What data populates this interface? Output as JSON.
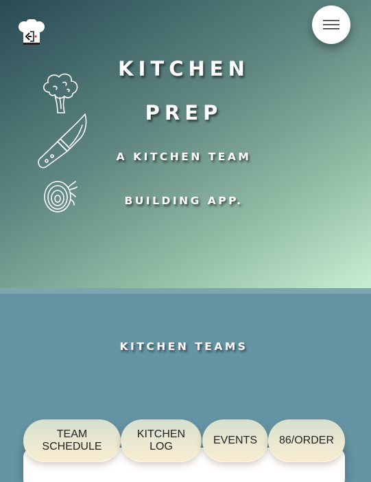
{
  "header": {
    "logo_icon": "chef-hat-code-logo-icon",
    "menu_icon": "hamburger-menu-icon"
  },
  "hero": {
    "title_line_1": "KITCHEN",
    "title_line_2": "PREP",
    "tagline_line_1": "A KITCHEN TEAM",
    "tagline_line_2": "BUILDING APP.",
    "illustrations": [
      "broccoli-icon",
      "chef-knife-icon",
      "onion-icon"
    ]
  },
  "teams": {
    "section_title": "KITCHEN TEAMS",
    "tabs": [
      {
        "label": "TEAM\nSCHEDULE"
      },
      {
        "label": "KITCHEN\nLOG"
      },
      {
        "label": "EVENTS"
      },
      {
        "label": "86/ORDER"
      }
    ]
  },
  "colors": {
    "hero_gradient_start": "#284a55",
    "hero_gradient_end": "#c6efd2",
    "teams_background": "#6594a5",
    "tab_background": "#ebe9d2",
    "text_light": "#ffffff"
  }
}
